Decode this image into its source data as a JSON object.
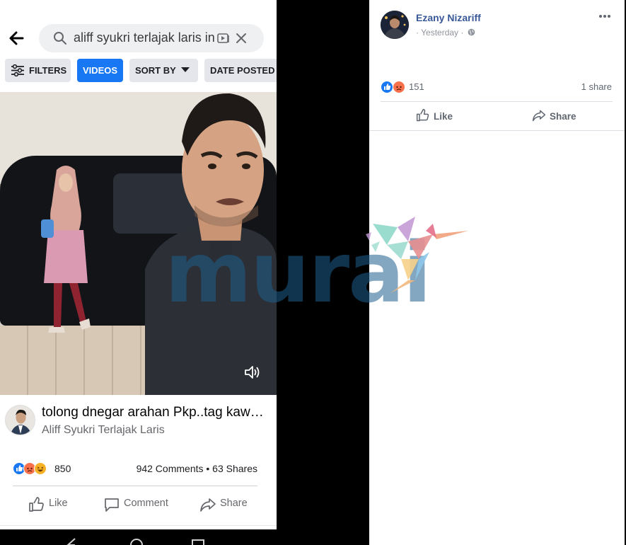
{
  "mobile": {
    "search": {
      "query": "aliff syukri terlajak laris in"
    },
    "filters": [
      {
        "label": "FILTERS",
        "active": false
      },
      {
        "label": "VIDEOS",
        "active": true
      },
      {
        "label": "SORT BY",
        "active": false
      },
      {
        "label": "DATE POSTED",
        "active": false
      }
    ],
    "post": {
      "title": "tolong dnegar arahan Pkp..tag kawa...",
      "author": "Aliff Syukri Terlajak Laris",
      "reaction_count": "850",
      "comments_shares": "942 Comments • 63 Shares",
      "actions": {
        "like": "Like",
        "comment": "Comment",
        "share": "Share"
      }
    },
    "colors": {
      "accent": "#1877f2",
      "chip_bg": "#e4e6eb",
      "like_blue": "#1877f2",
      "angry_orange": "#f7714c",
      "haha_yellow": "#f7b125"
    },
    "icons": [
      "back-arrow-icon",
      "search-icon",
      "video-icon",
      "close-icon",
      "filter-sliders-icon",
      "caret-down-icon",
      "sound-icon",
      "like-icon",
      "comment-icon",
      "share-icon",
      "nav-back-icon",
      "nav-home-icon",
      "nav-recent-icon"
    ]
  },
  "desktop": {
    "author": "Ezany Nizariff",
    "time": "· Yesterday ·",
    "reaction_count": "151",
    "shares": "1 share",
    "actions": {
      "like": "Like",
      "share": "Share"
    },
    "colors": {
      "author_blue": "#385898",
      "meta_gray": "#90949c"
    },
    "icons": [
      "globe-icon",
      "more-options-icon",
      "like-icon",
      "share-icon"
    ]
  },
  "watermark": {
    "text": "murai"
  }
}
